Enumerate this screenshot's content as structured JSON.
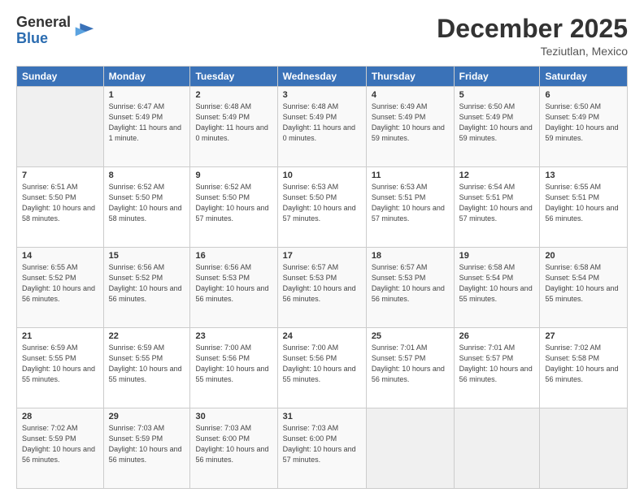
{
  "header": {
    "logo_line1": "General",
    "logo_line2": "Blue",
    "month": "December 2025",
    "location": "Teziutlan, Mexico"
  },
  "columns": [
    "Sunday",
    "Monday",
    "Tuesday",
    "Wednesday",
    "Thursday",
    "Friday",
    "Saturday"
  ],
  "weeks": [
    [
      {
        "day": "",
        "info": ""
      },
      {
        "day": "1",
        "info": "Sunrise: 6:47 AM\nSunset: 5:49 PM\nDaylight: 11 hours\nand 1 minute."
      },
      {
        "day": "2",
        "info": "Sunrise: 6:48 AM\nSunset: 5:49 PM\nDaylight: 11 hours\nand 0 minutes."
      },
      {
        "day": "3",
        "info": "Sunrise: 6:48 AM\nSunset: 5:49 PM\nDaylight: 11 hours\nand 0 minutes."
      },
      {
        "day": "4",
        "info": "Sunrise: 6:49 AM\nSunset: 5:49 PM\nDaylight: 10 hours\nand 59 minutes."
      },
      {
        "day": "5",
        "info": "Sunrise: 6:50 AM\nSunset: 5:49 PM\nDaylight: 10 hours\nand 59 minutes."
      },
      {
        "day": "6",
        "info": "Sunrise: 6:50 AM\nSunset: 5:49 PM\nDaylight: 10 hours\nand 59 minutes."
      }
    ],
    [
      {
        "day": "7",
        "info": "Sunrise: 6:51 AM\nSunset: 5:50 PM\nDaylight: 10 hours\nand 58 minutes."
      },
      {
        "day": "8",
        "info": "Sunrise: 6:52 AM\nSunset: 5:50 PM\nDaylight: 10 hours\nand 58 minutes."
      },
      {
        "day": "9",
        "info": "Sunrise: 6:52 AM\nSunset: 5:50 PM\nDaylight: 10 hours\nand 57 minutes."
      },
      {
        "day": "10",
        "info": "Sunrise: 6:53 AM\nSunset: 5:50 PM\nDaylight: 10 hours\nand 57 minutes."
      },
      {
        "day": "11",
        "info": "Sunrise: 6:53 AM\nSunset: 5:51 PM\nDaylight: 10 hours\nand 57 minutes."
      },
      {
        "day": "12",
        "info": "Sunrise: 6:54 AM\nSunset: 5:51 PM\nDaylight: 10 hours\nand 57 minutes."
      },
      {
        "day": "13",
        "info": "Sunrise: 6:55 AM\nSunset: 5:51 PM\nDaylight: 10 hours\nand 56 minutes."
      }
    ],
    [
      {
        "day": "14",
        "info": "Sunrise: 6:55 AM\nSunset: 5:52 PM\nDaylight: 10 hours\nand 56 minutes."
      },
      {
        "day": "15",
        "info": "Sunrise: 6:56 AM\nSunset: 5:52 PM\nDaylight: 10 hours\nand 56 minutes."
      },
      {
        "day": "16",
        "info": "Sunrise: 6:56 AM\nSunset: 5:53 PM\nDaylight: 10 hours\nand 56 minutes."
      },
      {
        "day": "17",
        "info": "Sunrise: 6:57 AM\nSunset: 5:53 PM\nDaylight: 10 hours\nand 56 minutes."
      },
      {
        "day": "18",
        "info": "Sunrise: 6:57 AM\nSunset: 5:53 PM\nDaylight: 10 hours\nand 56 minutes."
      },
      {
        "day": "19",
        "info": "Sunrise: 6:58 AM\nSunset: 5:54 PM\nDaylight: 10 hours\nand 55 minutes."
      },
      {
        "day": "20",
        "info": "Sunrise: 6:58 AM\nSunset: 5:54 PM\nDaylight: 10 hours\nand 55 minutes."
      }
    ],
    [
      {
        "day": "21",
        "info": "Sunrise: 6:59 AM\nSunset: 5:55 PM\nDaylight: 10 hours\nand 55 minutes."
      },
      {
        "day": "22",
        "info": "Sunrise: 6:59 AM\nSunset: 5:55 PM\nDaylight: 10 hours\nand 55 minutes."
      },
      {
        "day": "23",
        "info": "Sunrise: 7:00 AM\nSunset: 5:56 PM\nDaylight: 10 hours\nand 55 minutes."
      },
      {
        "day": "24",
        "info": "Sunrise: 7:00 AM\nSunset: 5:56 PM\nDaylight: 10 hours\nand 55 minutes."
      },
      {
        "day": "25",
        "info": "Sunrise: 7:01 AM\nSunset: 5:57 PM\nDaylight: 10 hours\nand 56 minutes."
      },
      {
        "day": "26",
        "info": "Sunrise: 7:01 AM\nSunset: 5:57 PM\nDaylight: 10 hours\nand 56 minutes."
      },
      {
        "day": "27",
        "info": "Sunrise: 7:02 AM\nSunset: 5:58 PM\nDaylight: 10 hours\nand 56 minutes."
      }
    ],
    [
      {
        "day": "28",
        "info": "Sunrise: 7:02 AM\nSunset: 5:59 PM\nDaylight: 10 hours\nand 56 minutes."
      },
      {
        "day": "29",
        "info": "Sunrise: 7:03 AM\nSunset: 5:59 PM\nDaylight: 10 hours\nand 56 minutes."
      },
      {
        "day": "30",
        "info": "Sunrise: 7:03 AM\nSunset: 6:00 PM\nDaylight: 10 hours\nand 56 minutes."
      },
      {
        "day": "31",
        "info": "Sunrise: 7:03 AM\nSunset: 6:00 PM\nDaylight: 10 hours\nand 57 minutes."
      },
      {
        "day": "",
        "info": ""
      },
      {
        "day": "",
        "info": ""
      },
      {
        "day": "",
        "info": ""
      }
    ]
  ]
}
